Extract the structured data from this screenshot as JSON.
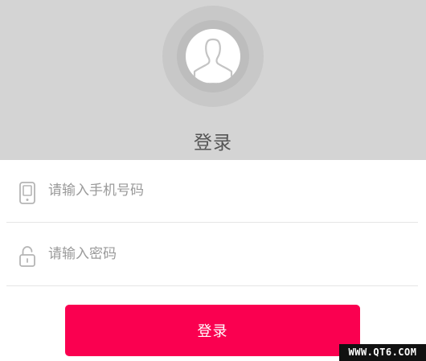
{
  "header": {
    "title": "登录"
  },
  "avatar": {
    "icon": "user-silhouette-icon"
  },
  "form": {
    "phone": {
      "icon": "mobile-phone-icon",
      "value": "",
      "placeholder": "请输入手机号码"
    },
    "password": {
      "icon": "padlock-icon",
      "value": "",
      "placeholder": "请输入密码"
    }
  },
  "login_button": {
    "label": "登录"
  },
  "watermark": {
    "text": "WWW.QT6.COM"
  },
  "colors": {
    "header_bg": "#d4d4d4",
    "primary": "#fa0050",
    "placeholder": "#9a9a9a",
    "divider": "#e6e6e6"
  }
}
